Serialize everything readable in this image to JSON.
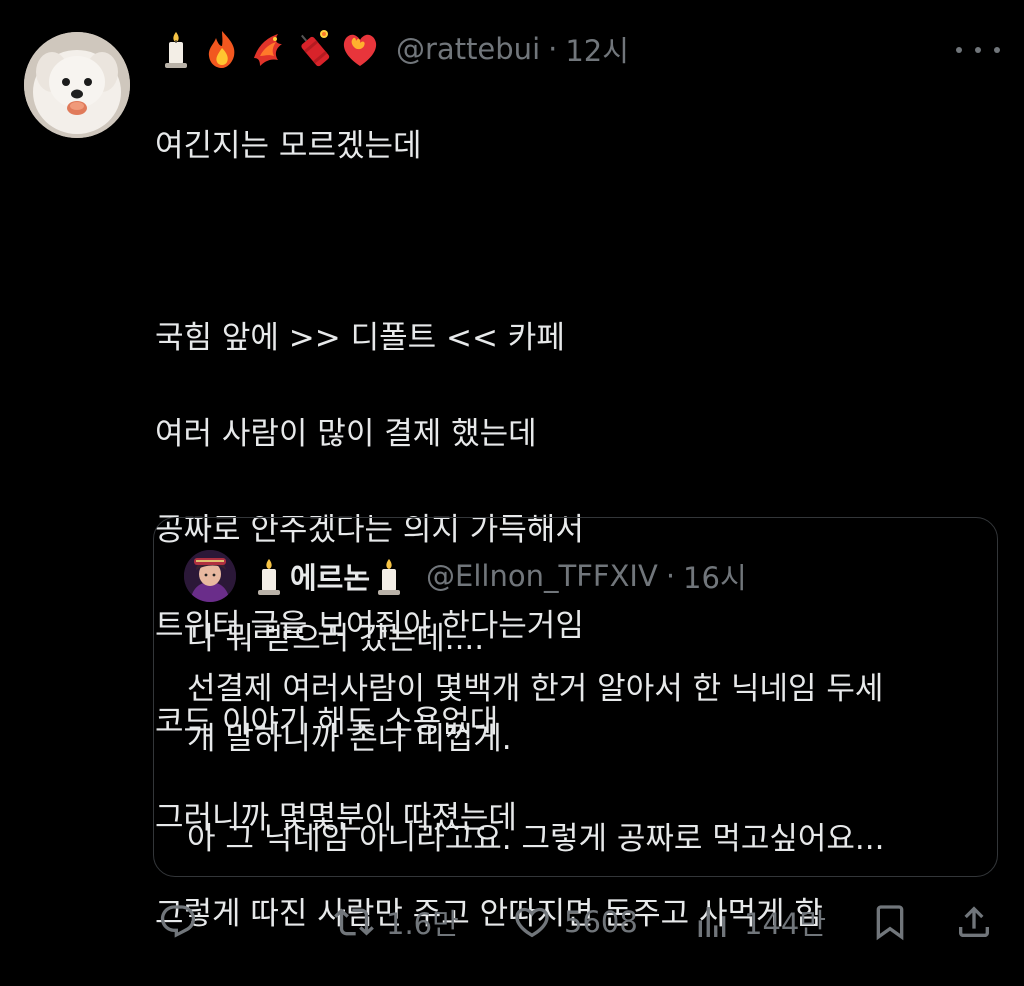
{
  "post": {
    "emojis": [
      "candle-emoji",
      "fire-emoji",
      "phoenix-emoji",
      "firecracker-emoji",
      "heart-on-fire-emoji"
    ],
    "handle": "@rattebui",
    "separator": "·",
    "time": "12시",
    "lines": [
      "여긴지는 모르겠는데",
      "",
      "국힘 앞에 >> 디폴트 << 카페",
      "여러 사람이 많이 결제 했는데",
      "공짜로 안주겠다는 의지 가득해서",
      "트위터 글을 보여줘야 한다는거임",
      "코드 이야기 해도 소용없대",
      "그러니까 몇몇분이 따졌는데",
      "그렇게 따진 사람만 주고 안따지면 돈주고 사먹게 함"
    ]
  },
  "quote": {
    "name": "에르논",
    "handle": "@Ellnon_TFFXIV",
    "separator": "·",
    "time": "16시",
    "lines": [
      "나 뭐 받으러 갔는데....",
      "선결제 여러사람이 몇백개 한거 알아서 한 닉네임 두세",
      "개 말하니까 존나 띠껍게.",
      "",
      "아 그 닉네임 아니라고요. 그렇게 공짜로 먹고싶어요..."
    ]
  },
  "actions": {
    "reply_icon": "reply-icon",
    "retweet_count": "1.6만",
    "like_count": "5608",
    "views_count": "144만",
    "bookmark_icon": "bookmark-icon",
    "share_icon": "share-icon"
  },
  "colors": {
    "background": "#000000",
    "text": "#e7e9ea",
    "muted": "#71767b",
    "border": "#333639"
  }
}
